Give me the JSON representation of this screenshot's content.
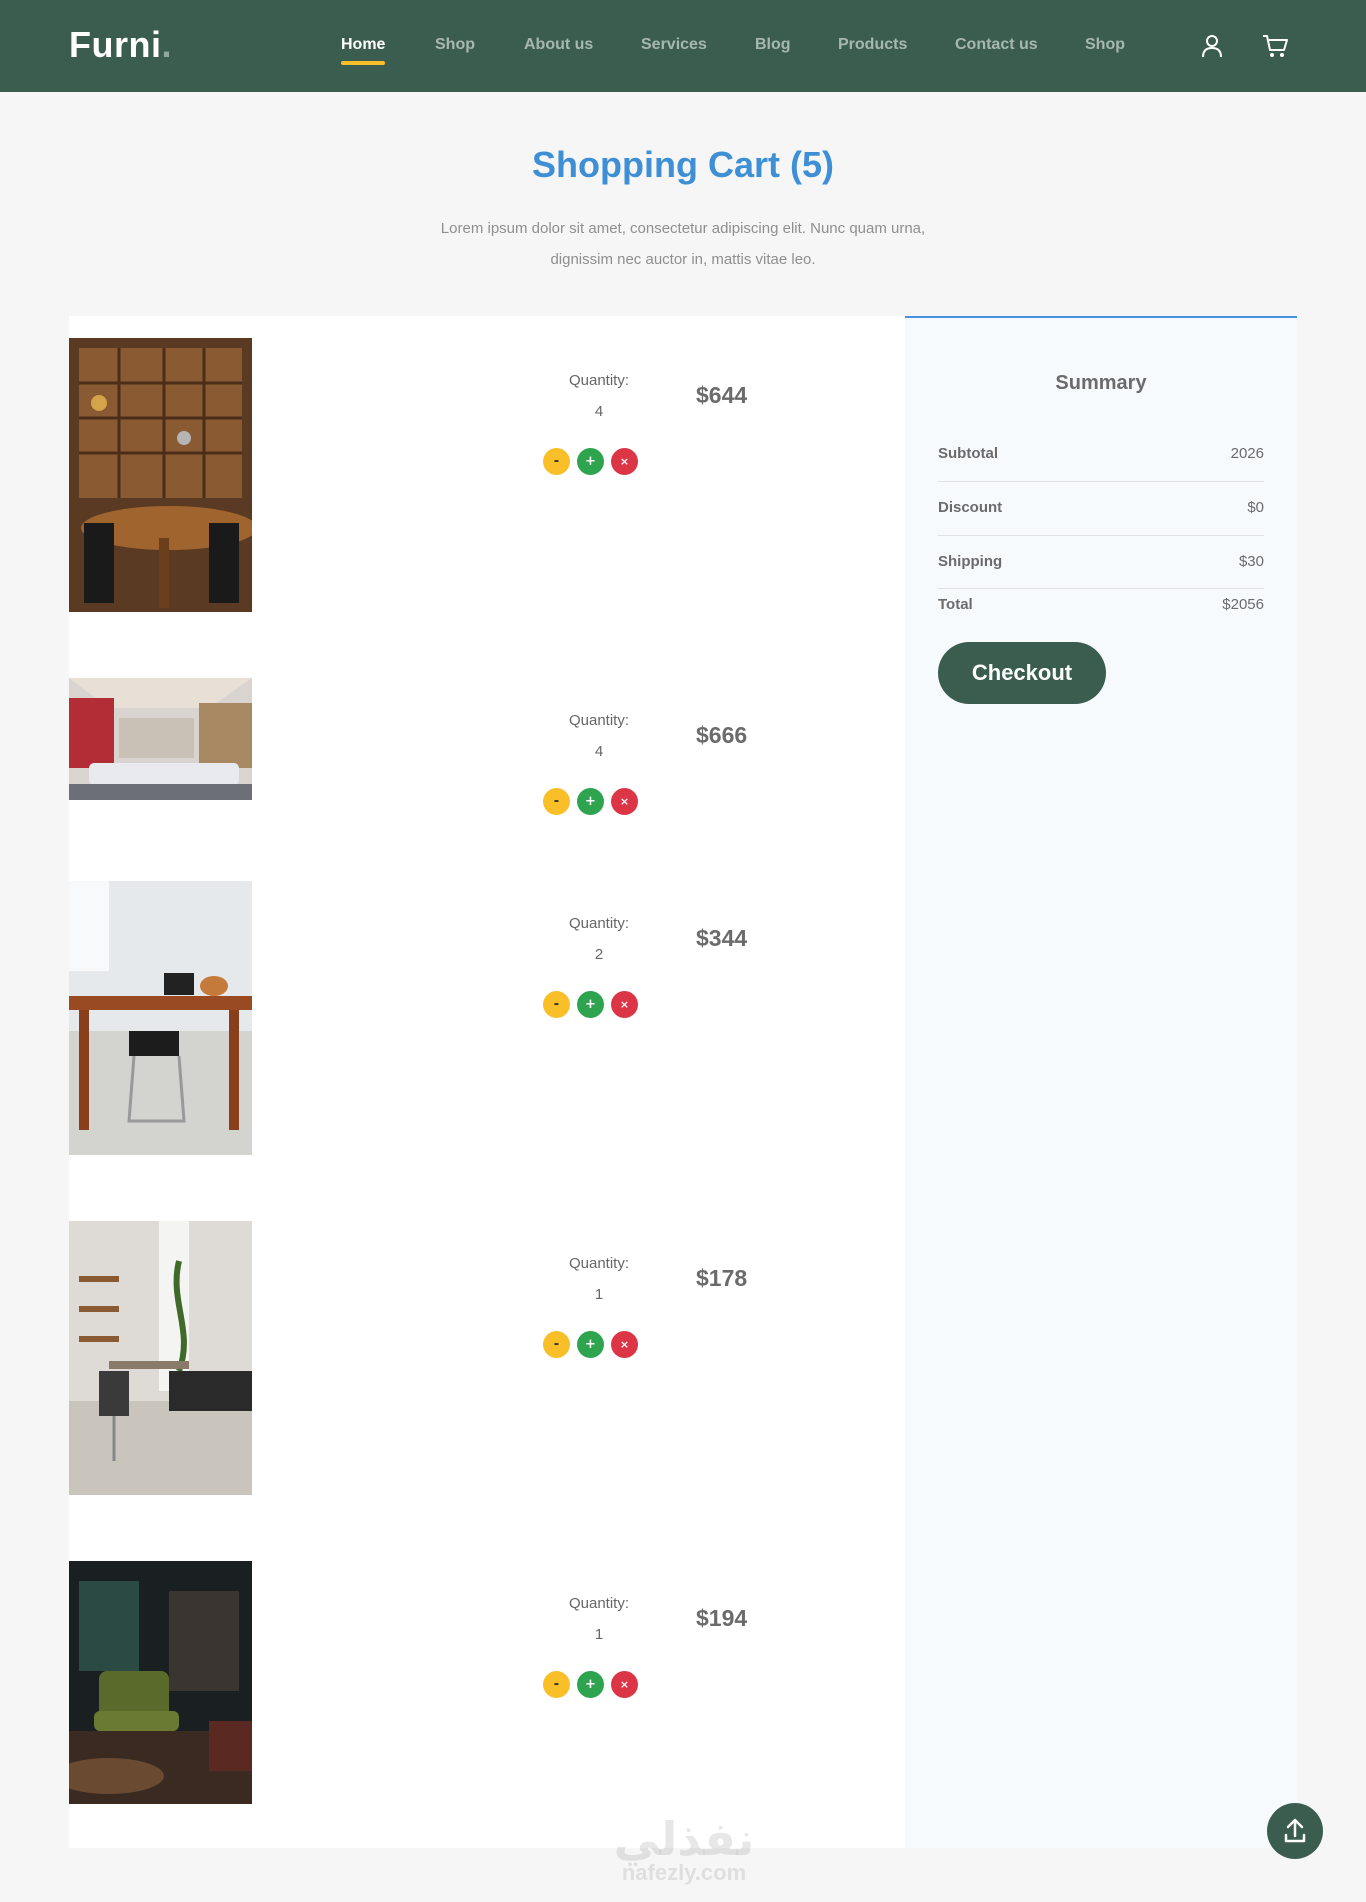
{
  "brand": {
    "name": "Furni",
    "dot": "."
  },
  "nav": {
    "items": [
      {
        "label": "Home",
        "active": true
      },
      {
        "label": "Shop"
      },
      {
        "label": "About us"
      },
      {
        "label": "Services"
      },
      {
        "label": "Blog"
      },
      {
        "label": "Products"
      },
      {
        "label": "Contact us"
      },
      {
        "label": "Shop"
      }
    ],
    "icons": [
      "user-icon",
      "cart-icon"
    ]
  },
  "page": {
    "title": "Shopping Cart (5)",
    "subtitle": "Lorem ipsum dolor sit amet, consectetur adipiscing elit. Nunc quam urna, dignissim nec auctor in, mattis vitae leo."
  },
  "cart": {
    "quantity_label": "Quantity:",
    "buttons": {
      "decrease": "-",
      "increase": "+",
      "remove": "×"
    },
    "items": [
      {
        "quantity": "4",
        "price": "$644",
        "image": "dining-room-shelves"
      },
      {
        "quantity": "4",
        "price": "$666",
        "image": "living-room-sofa"
      },
      {
        "quantity": "2",
        "price": "$344",
        "image": "wooden-desk-chair"
      },
      {
        "quantity": "1",
        "price": "$178",
        "image": "office-desk-plants"
      },
      {
        "quantity": "1",
        "price": "$194",
        "image": "dark-lounge-chair"
      }
    ]
  },
  "summary": {
    "title": "Summary",
    "subtotal_label": "Subtotal",
    "subtotal": "2026",
    "discount_label": "Discount",
    "discount": "$0",
    "shipping_label": "Shipping",
    "shipping": "$30",
    "total_label": "Total",
    "total": "$2056",
    "checkout_label": "Checkout"
  },
  "watermark": {
    "arabic": "نفذلي",
    "latin": "nafezly.com"
  },
  "colors": {
    "header": "#3b5d50",
    "accent": "#f9bf29",
    "title": "#3e8fd6",
    "plus": "#2ea44f",
    "remove": "#dc3545"
  }
}
